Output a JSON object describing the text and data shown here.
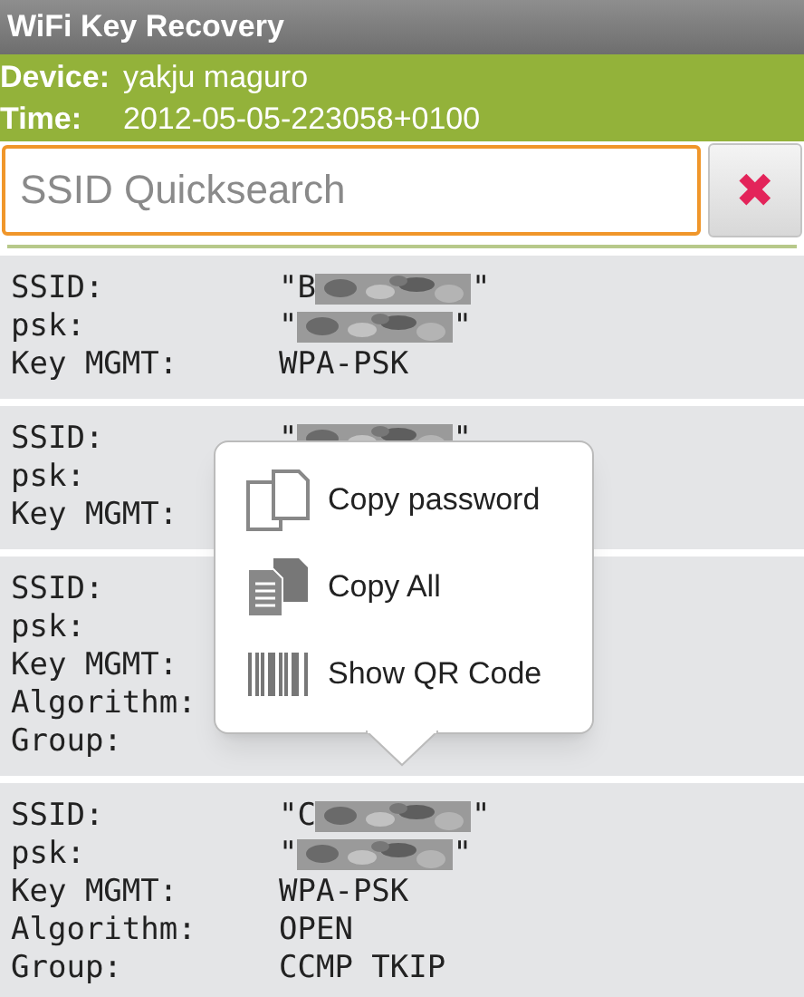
{
  "window": {
    "title": "WiFi Key Recovery"
  },
  "header": [
    {
      "label": "Device:",
      "value": "yakju maguro"
    },
    {
      "label": "Time:",
      "value": "2012-05-05-223058+0100"
    }
  ],
  "search": {
    "placeholder": "SSID Quicksearch",
    "clear_button": "✖"
  },
  "entries": [
    {
      "fields": [
        {
          "label": "SSID:",
          "value_start": "\"B",
          "redacted": true,
          "value_end": "\""
        },
        {
          "label": "psk:",
          "value_start": "\"",
          "redacted": true,
          "value_end": "\""
        },
        {
          "label": "Key MGMT:",
          "value_start": "WPA-PSK"
        }
      ]
    },
    {
      "fields": [
        {
          "label": "SSID:",
          "value_start": "\"",
          "redacted": true,
          "value_end": "\""
        },
        {
          "label": "psk:"
        },
        {
          "label": "Key MGMT:"
        }
      ]
    },
    {
      "fields": [
        {
          "label": "SSID:"
        },
        {
          "label": "psk:"
        },
        {
          "label": "Key MGMT:"
        },
        {
          "label": "Algorithm:"
        },
        {
          "label": "Group:"
        }
      ]
    },
    {
      "fields": [
        {
          "label": "SSID:",
          "value_start": "\"C",
          "redacted": true,
          "value_end": "\""
        },
        {
          "label": "psk:",
          "value_start": "\"",
          "redacted": true,
          "value_end": "\""
        },
        {
          "label": "Key MGMT:",
          "value_start": "WPA-PSK"
        },
        {
          "label": "Algorithm:",
          "value_start": "OPEN"
        },
        {
          "label": "Group:",
          "value_start": "CCMP TKIP"
        }
      ]
    }
  ],
  "context_menu": {
    "items": [
      {
        "kind": "copy",
        "label": "Copy password"
      },
      {
        "kind": "copy_all",
        "label": "Copy All"
      },
      {
        "kind": "barcode",
        "label": "Show QR Code"
      }
    ]
  }
}
